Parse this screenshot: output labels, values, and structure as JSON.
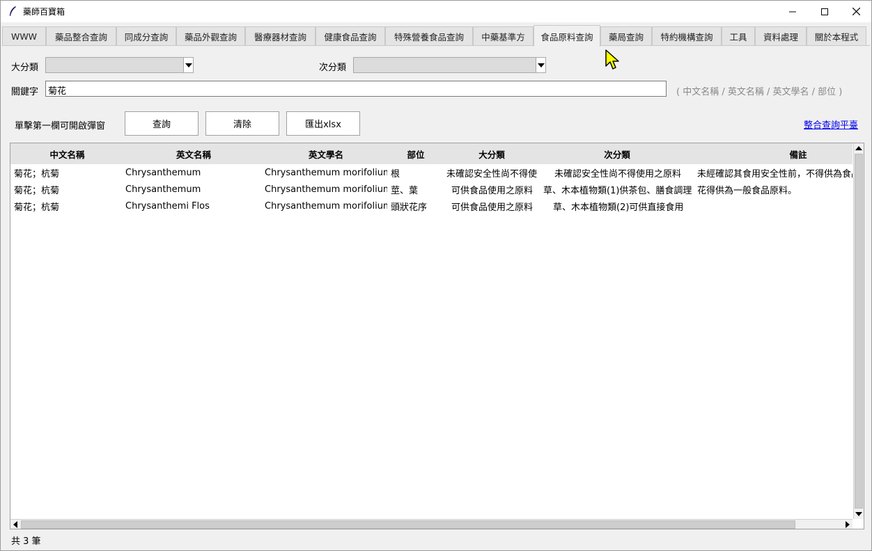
{
  "window": {
    "title": "藥師百寶箱",
    "minimize_symbol": "—",
    "maximize_symbol": "☐",
    "close_symbol": "✕"
  },
  "tabs": [
    {
      "label": "WWW"
    },
    {
      "label": "藥品整合查詢"
    },
    {
      "label": "同成分查詢"
    },
    {
      "label": "藥品外觀查詢"
    },
    {
      "label": "醫療器材查詢"
    },
    {
      "label": "健康食品查詢"
    },
    {
      "label": "特殊營養食品查詢"
    },
    {
      "label": "中藥基準方"
    },
    {
      "label": "食品原料查詢",
      "active": true
    },
    {
      "label": "藥局查詢"
    },
    {
      "label": "特約機構查詢"
    },
    {
      "label": "工具"
    },
    {
      "label": "資料處理"
    },
    {
      "label": "關於本程式"
    }
  ],
  "form": {
    "category_label": "大分類",
    "category_value": "",
    "subcategory_label": "次分類",
    "subcategory_value": "",
    "keyword_label": "關鍵字",
    "keyword_value": "菊花",
    "keyword_hint": "( 中文名稱 / 英文名稱 / 英文學名 / 部位 )",
    "tip": "單擊第一欄可開啟彈窗",
    "query_button": "查詢",
    "clear_button": "清除",
    "export_button": "匯出xlsx",
    "integrated_link": "整合查詢平臺"
  },
  "table": {
    "columns": [
      "中文名稱",
      "英文名稱",
      "英文學名",
      "部位",
      "大分類",
      "次分類",
      "備註"
    ],
    "rows": [
      [
        "菊花；杭菊",
        "Chrysanthemum",
        "Chrysanthemum morifolium",
        "根",
        "未確認安全性尚不得使",
        "未確認安全性尚不得使用之原料",
        "未經確認其食用安全性前，不得供為食品原料"
      ],
      [
        "菊花；杭菊",
        "Chrysanthemum",
        "Chrysanthemum morifolium",
        "莖、葉",
        "可供食品使用之原料",
        "草、木本植物類(1)供茶包、膳食調理",
        "花得供為一般食品原料。"
      ],
      [
        "菊花；杭菊",
        "Chrysanthemi Flos",
        "Chrysanthemum morifolium",
        "頭狀花序",
        "可供食品使用之原料",
        "草、木本植物類(2)可供直接食用",
        ""
      ]
    ]
  },
  "status": {
    "count_text": "共 3 筆"
  },
  "colors": {
    "link": "#0000ee",
    "header_bg": "#e4e4e4",
    "cursor": "#ffff00"
  }
}
